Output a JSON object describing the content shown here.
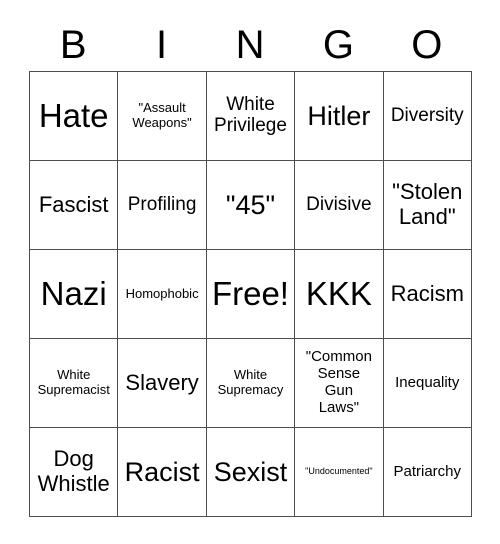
{
  "card": {
    "header_letters": [
      "B",
      "I",
      "N",
      "G",
      "O"
    ],
    "border_color": "#4d4d4d",
    "background_color": "#ffffff",
    "text_color": "#000000",
    "rows": [
      [
        {
          "label": "Hate",
          "size": "fs-huge"
        },
        {
          "label": "\"Assault\nWeapons\"",
          "size": "fs-sm"
        },
        {
          "label": "White\nPrivilege",
          "size": "fs-lg"
        },
        {
          "label": "Hitler",
          "size": "fs-xxl"
        },
        {
          "label": "Diversity",
          "size": "fs-lg"
        }
      ],
      [
        {
          "label": "Fascist",
          "size": "fs-xl"
        },
        {
          "label": "Profiling",
          "size": "fs-lg"
        },
        {
          "label": "\"45\"",
          "size": "fs-xxl"
        },
        {
          "label": "Divisive",
          "size": "fs-lg"
        },
        {
          "label": "\"Stolen\nLand\"",
          "size": "fs-xl"
        }
      ],
      [
        {
          "label": "Nazi",
          "size": "fs-huge"
        },
        {
          "label": "Homophobic",
          "size": "fs-sm"
        },
        {
          "label": "Free!",
          "size": "fs-huge"
        },
        {
          "label": "KKK",
          "size": "fs-huge"
        },
        {
          "label": "Racism",
          "size": "fs-xl"
        }
      ],
      [
        {
          "label": "White\nSupremacist",
          "size": "fs-sm"
        },
        {
          "label": "Slavery",
          "size": "fs-xl"
        },
        {
          "label": "White\nSupremacy",
          "size": "fs-sm"
        },
        {
          "label": "\"Common\nSense\nGun\nLaws\"",
          "size": "fs-md"
        },
        {
          "label": "Inequality",
          "size": "fs-md"
        }
      ],
      [
        {
          "label": "Dog\nWhistle",
          "size": "fs-xl"
        },
        {
          "label": "Racist",
          "size": "fs-xxl"
        },
        {
          "label": "Sexist",
          "size": "fs-xxl"
        },
        {
          "label": "\"Undocumented\"",
          "size": "fs-xs"
        },
        {
          "label": "Patriarchy",
          "size": "fs-md"
        }
      ]
    ]
  }
}
